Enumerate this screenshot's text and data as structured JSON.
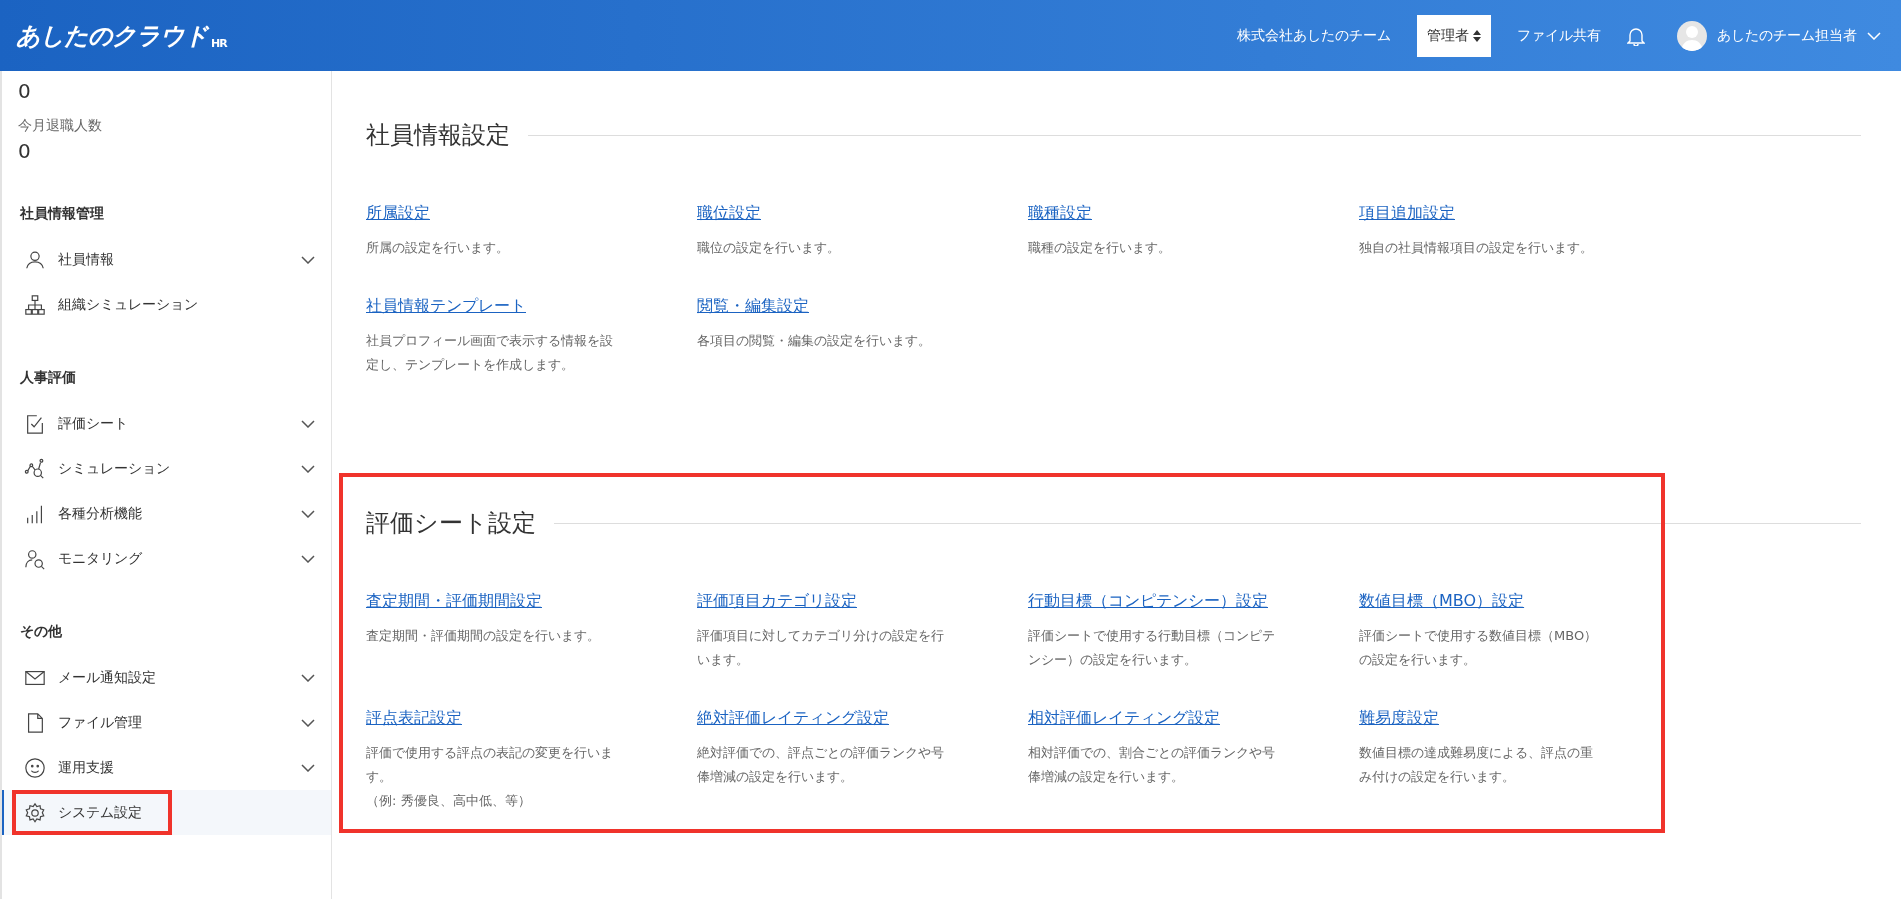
{
  "header": {
    "logo": "あしたのクラウド",
    "logo_suffix": "HR",
    "company": "株式会社あしたのチーム",
    "role": "管理者",
    "file_share": "ファイル共有",
    "user": "あしたのチーム担当者"
  },
  "sidebar": {
    "stats": [
      {
        "value": "0"
      },
      {
        "label": "今月退職人数",
        "value": "0"
      }
    ],
    "groups": [
      {
        "title": "社員情報管理",
        "items": [
          {
            "label": "社員情報",
            "expandable": true,
            "selected": false,
            "highlight": false
          },
          {
            "label": "組織シミュレーション",
            "expandable": false,
            "selected": false,
            "highlight": false
          }
        ]
      },
      {
        "title": "人事評価",
        "items": [
          {
            "label": "評価シート",
            "expandable": true,
            "selected": false,
            "highlight": false
          },
          {
            "label": "シミュレーション",
            "expandable": true,
            "selected": false,
            "highlight": false
          },
          {
            "label": "各種分析機能",
            "expandable": true,
            "selected": false,
            "highlight": false
          },
          {
            "label": "モニタリング",
            "expandable": true,
            "selected": false,
            "highlight": false
          }
        ]
      },
      {
        "title": "その他",
        "items": [
          {
            "label": "メール通知設定",
            "expandable": true,
            "selected": false,
            "highlight": false
          },
          {
            "label": "ファイル管理",
            "expandable": true,
            "selected": false,
            "highlight": false
          },
          {
            "label": "運用支援",
            "expandable": true,
            "selected": false,
            "highlight": false
          },
          {
            "label": "システム設定",
            "expandable": false,
            "selected": true,
            "highlight": true
          }
        ]
      }
    ]
  },
  "sections": [
    {
      "title": "社員情報設定",
      "highlight": false,
      "links": [
        {
          "label": "所属設定",
          "description": [
            "所属の設定を行います。"
          ]
        },
        {
          "label": "職位設定",
          "description": [
            "職位の設定を行います。"
          ]
        },
        {
          "label": "職種設定",
          "description": [
            "職種の設定を行います。"
          ]
        },
        {
          "label": "項目追加設定",
          "description": [
            "独自の社員情報項目の設定を行います。"
          ]
        },
        {
          "label": "社員情報テンプレート",
          "description": [
            "社員プロフィール画面で表示する情報を設",
            "定し、テンプレートを作成します。"
          ]
        },
        {
          "label": "閲覧・編集設定",
          "description": [
            "各項目の閲覧・編集の設定を行います。"
          ]
        }
      ]
    },
    {
      "title": "評価シート設定",
      "highlight": true,
      "links": [
        {
          "label": "査定期間・評価期間設定",
          "description": [
            "査定期間・評価期間の設定を行います。"
          ]
        },
        {
          "label": "評価項目カテゴリ設定",
          "description": [
            "評価項目に対してカテゴリ分けの設定を行",
            "います。"
          ]
        },
        {
          "label": "行動目標（コンピテンシー）設定",
          "description": [
            "評価シートで使用する行動目標（コンピテ",
            "ンシー）の設定を行います。"
          ]
        },
        {
          "label": "数値目標（MBO）設定",
          "description": [
            "評価シートで使用する数値目標（MBO）",
            "の設定を行います。"
          ]
        },
        {
          "label": "評点表記設定",
          "description": [
            "評価で使用する評点の表記の変更を行いま",
            "す。",
            "（例: 秀優良、高中低、等）"
          ]
        },
        {
          "label": "絶対評価レイティング設定",
          "description": [
            "絶対評価での、評点ごとの評価ランクや号",
            "俸増減の設定を行います。"
          ]
        },
        {
          "label": "相対評価レイティング設定",
          "description": [
            "相対評価での、割合ごとの評価ランクや号",
            "俸増減の設定を行います。"
          ]
        },
        {
          "label": "難易度設定",
          "description": [
            "数値目標の達成難易度による、評点の重",
            "み付けの設定を行います。"
          ]
        }
      ]
    }
  ]
}
